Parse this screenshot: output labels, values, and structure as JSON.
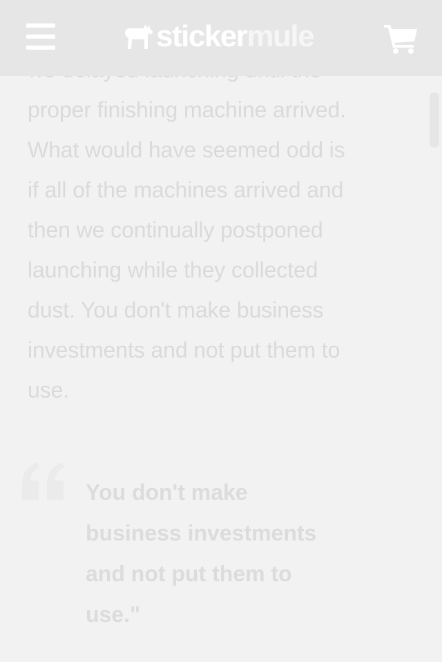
{
  "header": {
    "logo": {
      "word_primary": "sticker",
      "word_secondary": "mule",
      "icon": "mule-icon"
    },
    "menu_icon": "hamburger-menu-icon",
    "cart_icon": "shopping-cart-icon"
  },
  "article": {
    "paragraph_lines": [
      "we delayed launching until the",
      "proper finishing machine arrived.",
      "What would have seemed odd is",
      "if all of the machines arrived and",
      "then we continually postponed",
      "launching while they collected",
      "dust. You don't make business",
      "investments and not put them to",
      "use."
    ]
  },
  "pull_quote": {
    "icon": "quote-icon",
    "lines": [
      "You don't make",
      "business investments",
      "and not put them to",
      "use.\""
    ]
  },
  "colors": {
    "background": "#f2f2f2",
    "header_background": "#e6e6e6",
    "body_text": "#dadada",
    "quote_text": "#dcdcdc"
  }
}
